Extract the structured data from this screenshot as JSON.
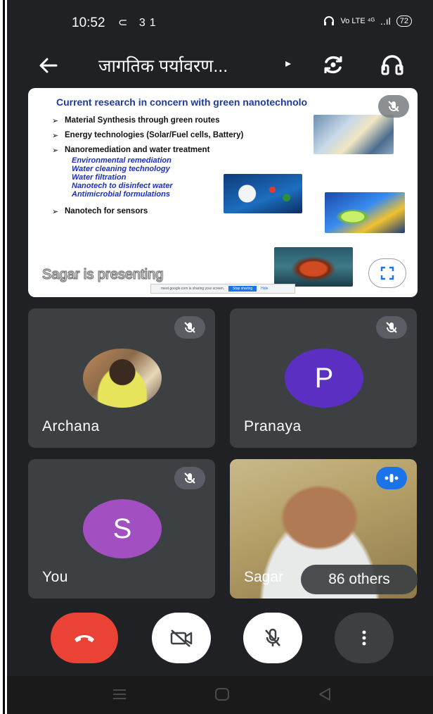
{
  "status_bar": {
    "time": "10:52",
    "left_icons": "⊂ 31",
    "network": "Vo LTE ⁴ᴳ",
    "signal": "..ıl",
    "battery": "72"
  },
  "app_bar": {
    "back_icon": "arrow-left",
    "meeting_title": "जागतिक पर्यावरण...",
    "caret_icon": "▸"
  },
  "presentation": {
    "slide_title": "Current research in concern with green nanotechnolo",
    "bullets": [
      "Material Synthesis through green routes",
      "Energy technologies (Solar/Fuel cells, Battery)",
      "Nanoremediation and water treatment"
    ],
    "sub_items": [
      "Environmental remediation",
      "Water cleaning technology",
      "Water filtration",
      "Nanotech to disinfect water",
      "Antimicrobial formulations"
    ],
    "last_bullet": "Nanotech for sensors",
    "presenter_label": "Sagar is presenting",
    "share_notice": "meet.google.com is sharing your screen.",
    "stop_sharing": "Stop sharing",
    "hide": "Hide"
  },
  "participants": [
    {
      "name": "Archana"
    },
    {
      "name": "Pranaya",
      "initial": "P"
    },
    {
      "name": "You",
      "initial": "S"
    },
    {
      "name": "Sagar"
    }
  ],
  "others_chip": "86 others",
  "colors": {
    "background": "#202124",
    "tile": "#3c4043",
    "end_call": "#ea4335",
    "avatar_p": "#5b2fc2",
    "avatar_s": "#a24fc2",
    "speaking": "#1a73e8"
  }
}
